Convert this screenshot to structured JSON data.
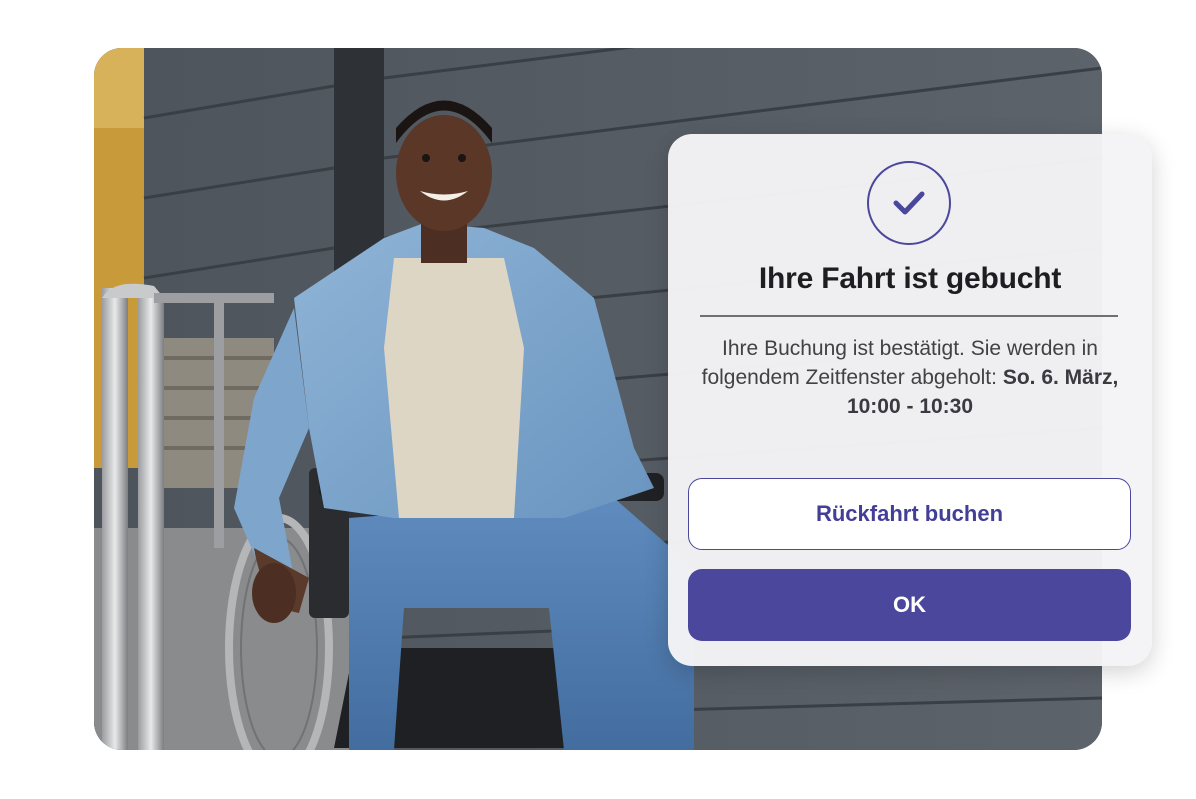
{
  "photo": {
    "alt": "Man in wheelchair smiling"
  },
  "dialog": {
    "icon": "checkmark-icon",
    "title": "Ihre Fahrt ist gebucht",
    "message_prefix": "Ihre Buchung ist bestätigt. Sie werden in folgendem Zeitfenster abgeholt: ",
    "message_time": "So. 6. März, 10:00 - 10:30",
    "return_trip_button": "Rückfahrt buchen",
    "ok_button": "OK"
  },
  "colors": {
    "accent": "#4a479c",
    "dialog_bg": "#f4f4f6",
    "title": "#1d1d22",
    "body_text": "#414146"
  }
}
